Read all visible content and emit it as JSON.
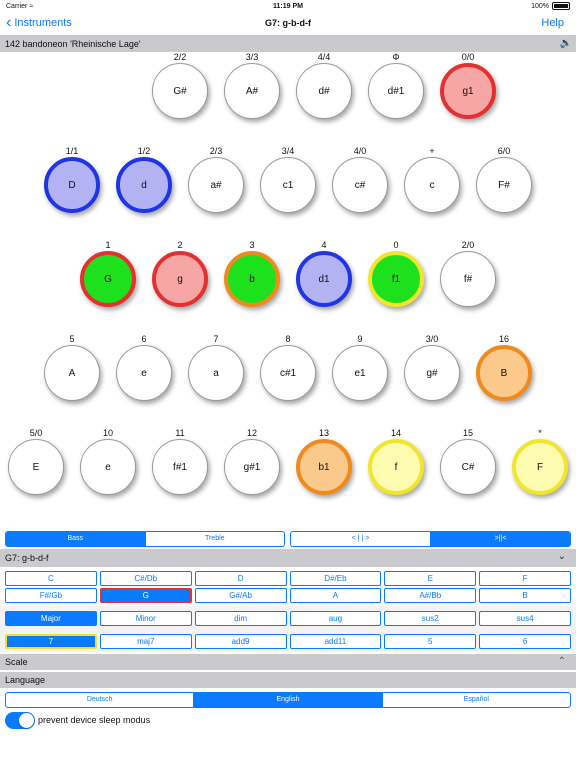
{
  "status": {
    "carrier": "Carrier",
    "time": "11:19 PM",
    "battery": "100%"
  },
  "nav": {
    "back": "Instruments",
    "title": "G7: g-b-d-f",
    "help": "Help"
  },
  "instrument": {
    "name": "142 bandoneon 'Rheinische Lage'"
  },
  "buttons": [
    {
      "label": "2/2",
      "note": "G#",
      "fill": "#ffffff",
      "ring": "none"
    },
    {
      "label": "3/3",
      "note": "A#",
      "fill": "#ffffff",
      "ring": "none"
    },
    {
      "label": "4/4",
      "note": "d#",
      "fill": "#ffffff",
      "ring": "none"
    },
    {
      "label": "Φ",
      "note": "d#1",
      "fill": "#ffffff",
      "ring": "none"
    },
    {
      "label": "0/0",
      "note": "g1",
      "fill": "#f7a6a6",
      "ring": "#e53030"
    },
    {
      "label": "1/1",
      "note": "D",
      "fill": "#b3b3f4",
      "ring": "#2035e6"
    },
    {
      "label": "1/2",
      "note": "d",
      "fill": "#b3b3f4",
      "ring": "#2035e6"
    },
    {
      "label": "2/3",
      "note": "a#",
      "fill": "#ffffff",
      "ring": "none"
    },
    {
      "label": "3/4",
      "note": "c1",
      "fill": "#ffffff",
      "ring": "none"
    },
    {
      "label": "4/0",
      "note": "c#",
      "fill": "#ffffff",
      "ring": "none"
    },
    {
      "label": "+",
      "note": "c",
      "fill": "#ffffff",
      "ring": "none"
    },
    {
      "label": "6/0",
      "note": "F#",
      "fill": "#ffffff",
      "ring": "none"
    },
    {
      "label": "1",
      "note": "G",
      "fill": "#1ee11e",
      "ring": "#e53030"
    },
    {
      "label": "2",
      "note": "g",
      "fill": "#f7a6a6",
      "ring": "#e53030"
    },
    {
      "label": "3",
      "note": "b",
      "fill": "#1ee11e",
      "ring": "#f08a1c"
    },
    {
      "label": "4",
      "note": "d1",
      "fill": "#b3b3f4",
      "ring": "#2035e6"
    },
    {
      "label": "0",
      "note": "f1",
      "fill": "#1ee11e",
      "ring": "#f2e52a"
    },
    {
      "label": "2/0",
      "note": "f#",
      "fill": "#ffffff",
      "ring": "none"
    },
    {
      "label": "5",
      "note": "A",
      "fill": "#ffffff",
      "ring": "none"
    },
    {
      "label": "6",
      "note": "e",
      "fill": "#ffffff",
      "ring": "none"
    },
    {
      "label": "7",
      "note": "a",
      "fill": "#ffffff",
      "ring": "none"
    },
    {
      "label": "8",
      "note": "c#1",
      "fill": "#ffffff",
      "ring": "none"
    },
    {
      "label": "9",
      "note": "e1",
      "fill": "#ffffff",
      "ring": "none"
    },
    {
      "label": "3/0",
      "note": "g#",
      "fill": "#ffffff",
      "ring": "none"
    },
    {
      "label": "16",
      "note": "B",
      "fill": "#fbc98c",
      "ring": "#f08a1c"
    },
    {
      "label": "5/0",
      "note": "E",
      "fill": "#ffffff",
      "ring": "none"
    },
    {
      "label": "10",
      "note": "e",
      "fill": "#ffffff",
      "ring": "none"
    },
    {
      "label": "11",
      "note": "f#1",
      "fill": "#ffffff",
      "ring": "none"
    },
    {
      "label": "12",
      "note": "g#1",
      "fill": "#ffffff",
      "ring": "none"
    },
    {
      "label": "13",
      "note": "b1",
      "fill": "#fbc98c",
      "ring": "#f08a1c"
    },
    {
      "label": "14",
      "note": "f",
      "fill": "#fdfbb0",
      "ring": "#f2e52a"
    },
    {
      "label": "15",
      "note": "C#",
      "fill": "#ffffff",
      "ring": "none"
    },
    {
      "label": "*",
      "note": "F",
      "fill": "#fdfbb0",
      "ring": "#f2e52a"
    }
  ],
  "side_toggle": [
    {
      "label": "Bass",
      "selected": true
    },
    {
      "label": "Treble",
      "selected": false
    }
  ],
  "direction_toggle": [
    {
      "label": "< | | >",
      "selected": false
    },
    {
      "label": ">||<",
      "selected": true
    }
  ],
  "chord_header": "G7: g-b-d-f",
  "roots": [
    {
      "label": "C"
    },
    {
      "label": "C#/Db"
    },
    {
      "label": "D"
    },
    {
      "label": "D#/Eb"
    },
    {
      "label": "E"
    },
    {
      "label": "F"
    },
    {
      "label": "F#/Gb"
    },
    {
      "label": "G",
      "selected": true,
      "outline": "red"
    },
    {
      "label": "G#/Ab"
    },
    {
      "label": "A"
    },
    {
      "label": "A#/Bb"
    },
    {
      "label": "B"
    }
  ],
  "qualities": [
    {
      "label": "Major",
      "selected": true
    },
    {
      "label": "Minor"
    },
    {
      "label": "dim"
    },
    {
      "label": "aug"
    },
    {
      "label": "sus2"
    },
    {
      "label": "sus4"
    },
    {
      "label": "7",
      "selected": true,
      "outline": "yellow"
    },
    {
      "label": "maj7"
    },
    {
      "label": "add9"
    },
    {
      "label": "add11"
    },
    {
      "label": "5"
    },
    {
      "label": "6"
    }
  ],
  "scale_header": "Scale",
  "language_header": "Language",
  "languages": [
    {
      "label": "Deutsch",
      "selected": false
    },
    {
      "label": "English",
      "selected": true
    },
    {
      "label": "Español",
      "selected": false
    }
  ],
  "sleep": {
    "label": "prevent device sleep modus",
    "on": true
  }
}
